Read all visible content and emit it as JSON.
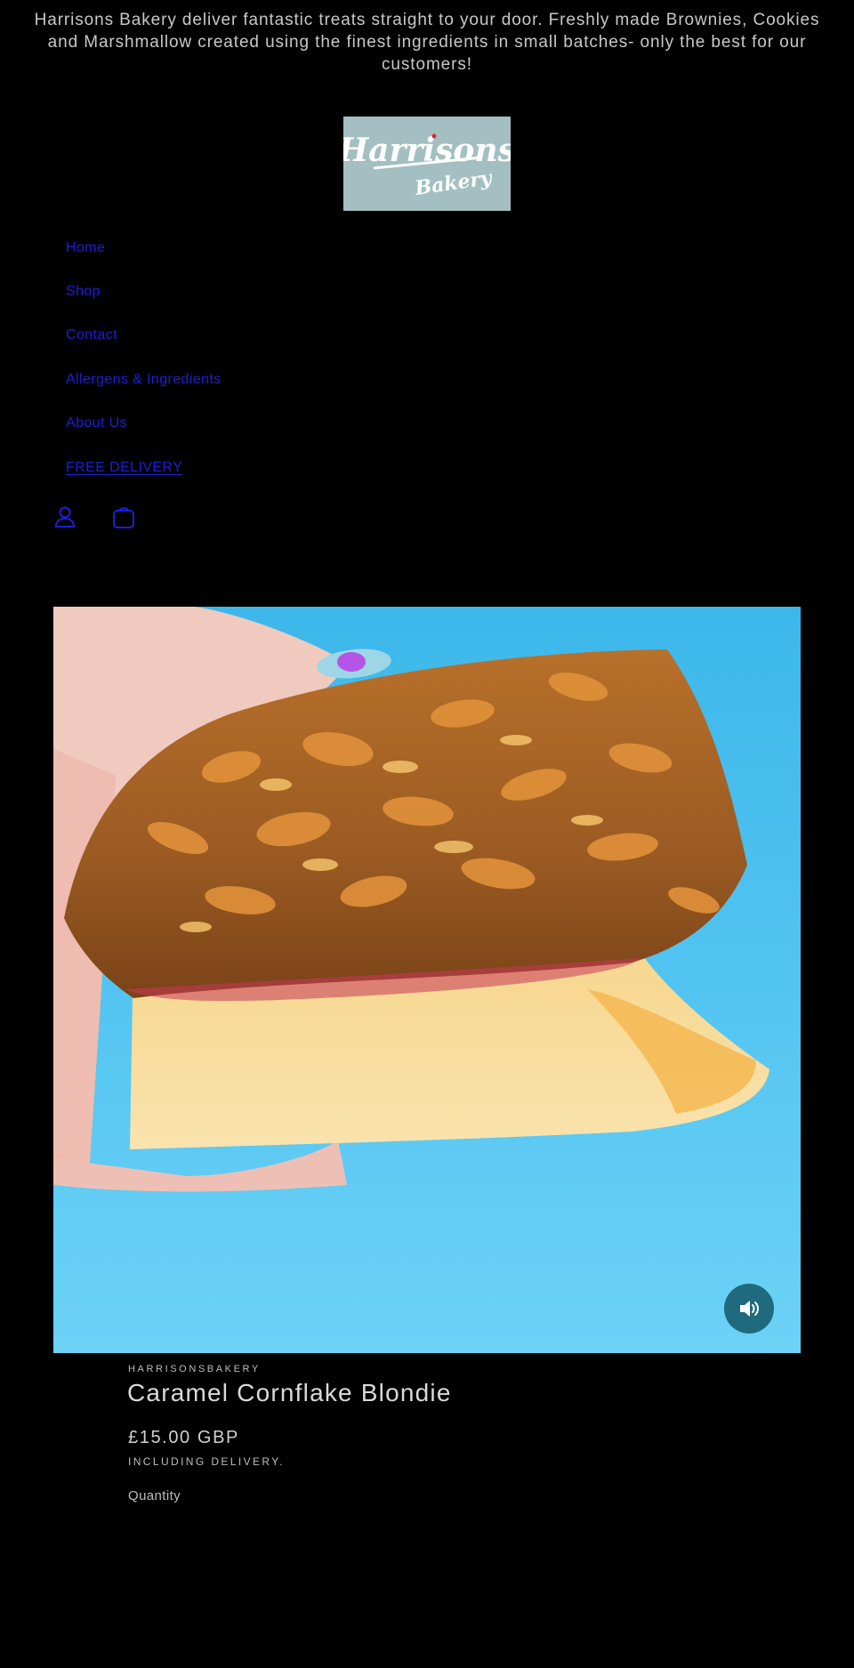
{
  "announcement": {
    "text": "Harrisons Bakery deliver fantastic treats straight to your door. Freshly made Brownies, Cookies and Marshmallow created using the finest ingredients in small batches- only the best for our customers!"
  },
  "logo": {
    "line1": "Harrisons",
    "line2": "Bakery",
    "background": "#a3bfc1"
  },
  "nav": {
    "items": [
      {
        "label": "Home"
      },
      {
        "label": "Shop"
      },
      {
        "label": "Contact"
      },
      {
        "label": "Allergens & Ingredients"
      },
      {
        "label": "About Us"
      },
      {
        "label": "FREE DELIVERY"
      }
    ],
    "link_color": "#1f1fd6"
  },
  "header_icons": {
    "account": "account-icon",
    "cart": "cart-icon"
  },
  "product": {
    "vendor": "HARRISONSBAKERY",
    "title": "Caramel Cornflake Blondie",
    "price": "£15.00 GBP",
    "tax_note": "INCLUDING DELIVERY.",
    "quantity_label": "Quantity",
    "media_icon": "volume-icon",
    "media_background": "#55c6ef",
    "sound_button_color": "#1f6a7d"
  }
}
